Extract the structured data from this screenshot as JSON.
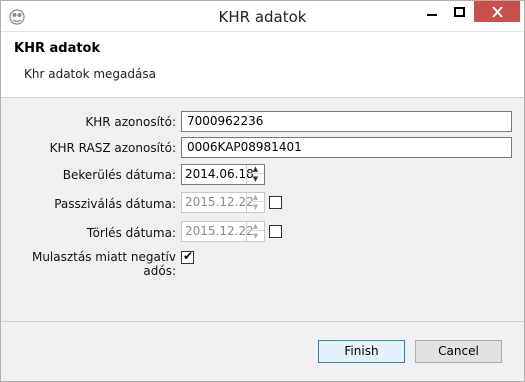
{
  "window": {
    "title": "KHR adatok",
    "buttons": {
      "minimize": "—",
      "maximize": "☐",
      "close": "✕"
    }
  },
  "header": {
    "title": "KHR adatok",
    "subtitle": "Khr adatok megadása"
  },
  "form": {
    "khr_id": {
      "label": "KHR azonosító:",
      "value": "7000962236"
    },
    "khr_rasz_id": {
      "label": "KHR RASZ azonosító:",
      "value": "0006KAP08981401"
    },
    "bekerules": {
      "label": "Bekerülés dátuma:",
      "value": "2014.06.18."
    },
    "passzivalas": {
      "label": "Passziválás dátuma:",
      "value": "2015.12.22.",
      "checked": false
    },
    "torles": {
      "label": "Törlés dátuma:",
      "value": "2015.12.22.",
      "checked": false
    },
    "mulasztas": {
      "label": "Mulasztás miatt negatív adós:",
      "checked": true
    }
  },
  "footer": {
    "finish_label": "Finish",
    "cancel_label": "Cancel"
  },
  "icons": {
    "app": "app-icon",
    "checkmark": "✔",
    "spin_up": "▲",
    "spin_down": "▼"
  },
  "colors": {
    "close_button": "#c7504b",
    "default_button_border": "#3c7fb1"
  }
}
